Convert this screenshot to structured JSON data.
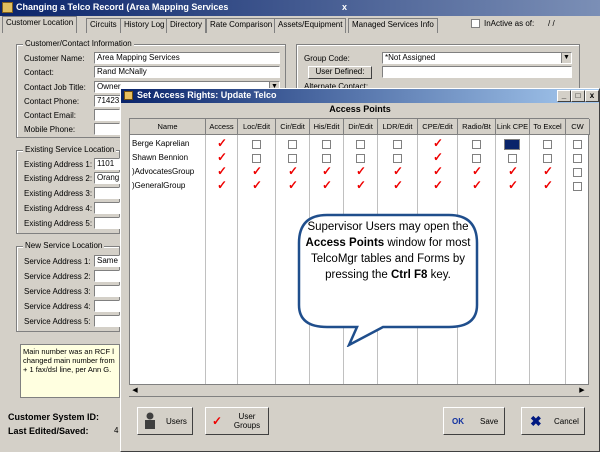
{
  "main": {
    "title": "Changing a Telco Record  (Area Mapping Services",
    "title_suffix": "x",
    "tabs": [
      "Customer Location",
      "Circuits",
      "History Log",
      "Directory",
      "Rate Comparison",
      "Assets/Equipment",
      "Managed Services Info"
    ],
    "inactive_label": "InActive as of:",
    "inactive_value": "/ /",
    "contact_group": {
      "title": "Customer/Contact Information",
      "customer_name_label": "Customer Name:",
      "customer_name_value": "Area Mapping Services",
      "contact_label": "Contact:",
      "contact_value": "Rand McNally",
      "job_title_label": "Contact Job Title:",
      "job_title_value": "Owner",
      "phone_label": "Contact Phone:",
      "phone_value": "714231",
      "email_label": "Contact Email:",
      "mobile_label": "Mobile Phone:"
    },
    "right_group": {
      "group_code_label": "Group Code:",
      "group_code_value": "*Not Assigned",
      "user_defined_label": "User Defined:",
      "alternate_contact_label": "Alternate Contact:"
    },
    "existing_group": {
      "title": "Existing Service Location",
      "labels": [
        "Existing Address 1:",
        "Existing Address 2:",
        "Existing Address 3:",
        "Existing Address 4:",
        "Existing Address 5:"
      ],
      "values": [
        "1101",
        "Orang",
        "",
        "",
        ""
      ]
    },
    "new_group": {
      "title": "New Service Location",
      "labels": [
        "Service Address 1:",
        "Service Address 2:",
        "Service Address 3:",
        "Service Address 4:",
        "Service Address 5:"
      ],
      "values": [
        "Same",
        "",
        "",
        "",
        ""
      ]
    },
    "notes": "Main number was an RCF l changed main number from + 1 fax/dsl line, per Ann G.",
    "system_id_label": "Customer System ID:",
    "last_edited_label": "Last Edited/Saved:",
    "last_edited_value": "4"
  },
  "dialog": {
    "title": "Set Access Rights: Update Telco",
    "section_title": "Access Points",
    "columns": [
      "Name",
      "Access",
      "Loc/Edit",
      "Cir/Edit",
      "His/Edit",
      "Dir/Edit",
      "LDR/Edit",
      "CPE/Edit",
      "Radio/Bt",
      "Link CPE",
      "To Excel",
      "CW"
    ],
    "rows": [
      {
        "name": "Berge Kaprelian",
        "checks": [
          1,
          0,
          0,
          0,
          0,
          0,
          1,
          0,
          0,
          0,
          0
        ]
      },
      {
        "name": "Shawn Bennion",
        "checks": [
          1,
          0,
          0,
          0,
          0,
          0,
          1,
          0,
          0,
          0,
          0
        ]
      },
      {
        "name": ")AdvocatesGroup",
        "checks": [
          1,
          1,
          1,
          1,
          1,
          1,
          1,
          1,
          1,
          1,
          0
        ]
      },
      {
        "name": ")GeneralGroup",
        "checks": [
          1,
          1,
          1,
          1,
          1,
          1,
          1,
          1,
          1,
          1,
          0
        ]
      }
    ],
    "callout_text_1": "Supervisor Users may open the ",
    "callout_bold_1": "Access Points",
    "callout_text_2": " window for most TelcoMgr tables and Forms by pressing the ",
    "callout_bold_2": "Ctrl F8",
    "callout_text_3": " key.",
    "buttons": {
      "users": "Users",
      "user_groups": "User Groups",
      "ok": "OK",
      "save": "Save",
      "cancel": "Cancel"
    },
    "colors": {
      "check": "#e00000",
      "title_start": "#0a246a",
      "ok": "#1030a0",
      "cancel_x": "#001880"
    }
  }
}
